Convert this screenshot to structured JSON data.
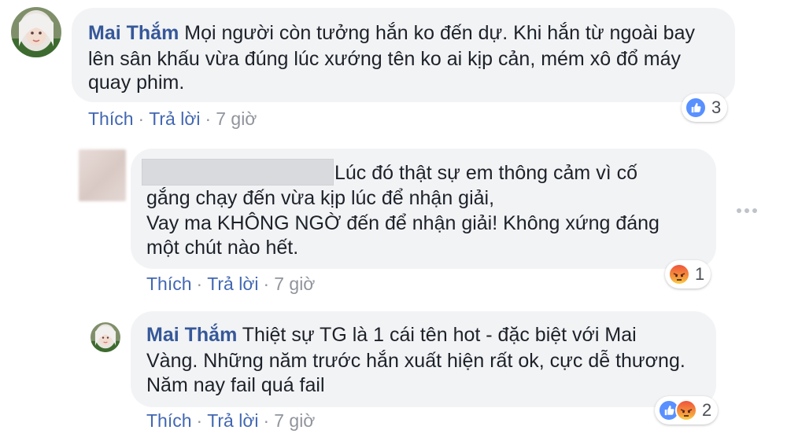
{
  "comment1": {
    "author": "Mai Thắm",
    "lines": [
      " Mọi người còn tưởng hắn ko đến dự. Khi hắn từ ngoài bay",
      "lên sân khấu vừa đúng lúc xướng tên ko ai kịp cản, mém xô đổ máy",
      "quay phim."
    ],
    "like_label": "Thích",
    "reply_label": "Trả lời",
    "time": "7 giờ",
    "reactions": {
      "icons": [
        "like-icon"
      ],
      "count": "3"
    }
  },
  "comment2": {
    "lines": [
      "Lúc đó thật sự em thông cảm vì cố",
      "gắng chạy đến vừa kịp lúc để nhận giải,",
      "Vay ma KHÔNG NGỜ đến để nhận giải! Không xứng đáng",
      "một chút nào hết."
    ],
    "like_label": "Thích",
    "reply_label": "Trả lời",
    "time": "7 giờ",
    "reactions": {
      "icons": [
        "angry-icon"
      ],
      "count": "1"
    }
  },
  "comment3": {
    "author": "Mai Thắm",
    "lines": [
      " Thiệt sự TG là 1 cái tên hot - đặc biệt với Mai",
      "Vàng. Những năm trước hắn xuất hiện rất ok, cực dễ thương.",
      "Năm nay fail quá fail"
    ],
    "like_label": "Thích",
    "reply_label": "Trả lời",
    "time": "7 giờ",
    "reactions": {
      "icons": [
        "like-icon",
        "angry-icon"
      ],
      "count": "2"
    }
  },
  "sep": "·",
  "colors": {
    "link": "#4267b2",
    "author": "#365899",
    "bubble": "#f2f3f5",
    "like": "#5890ff",
    "muted": "#90949c"
  }
}
